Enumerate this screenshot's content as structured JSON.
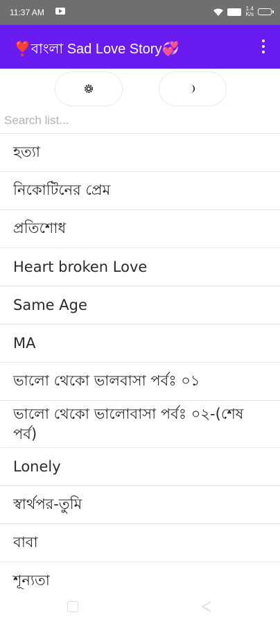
{
  "status": {
    "time": "11:37 AM",
    "speed": "1.4\nK/s"
  },
  "app": {
    "title": "❣️বাংলা  Sad Love Story💞"
  },
  "controls": {
    "settings_icon": "gear-icon",
    "theme_icon": "moon-icon"
  },
  "search": {
    "placeholder": "Search list..."
  },
  "list": {
    "items": [
      "হত্যা",
      "নিকোটিনের প্রেম",
      "প্রতিশোধ",
      "Heart broken Love",
      "Same Age",
      "MA",
      "ভালো থেকো ভালবাসা পর্বঃ ০১",
      "ভালো থেকো ভালোবাসা পর্বঃ ০২-(শেষ পর্ব)",
      "Lonely",
      "স্বার্থপর-তুমি",
      "বাবা",
      "শূন্যতা"
    ]
  }
}
